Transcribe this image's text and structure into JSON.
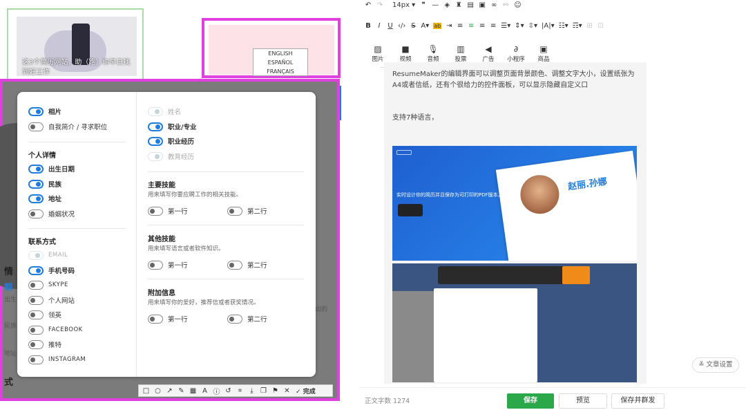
{
  "left": {
    "thumb_caption": "这3个简历网站，助（跑）你早日找到好工作",
    "languages": [
      "ENGLISH",
      "ESPAÑOL",
      "FRANÇAIS"
    ],
    "side_text": [
      "情",
      "朝",
      "出生",
      "民族",
      "地址",
      "式"
    ],
    "side_right": "出的"
  },
  "panel": {
    "col1": {
      "top_items": [
        {
          "label": "相片",
          "state": "on"
        },
        {
          "label": "自我简介 / 寻求职位",
          "state": "off"
        }
      ],
      "personal_title": "个人详情",
      "personal_items": [
        {
          "label": "出生日期",
          "state": "on"
        },
        {
          "label": "民族",
          "state": "on"
        },
        {
          "label": "地址",
          "state": "on"
        },
        {
          "label": "婚姻状况",
          "state": "off"
        }
      ],
      "contact_title": "联系方式",
      "contact_items": [
        {
          "label": "EMAIL",
          "state": "dis"
        },
        {
          "label": "手机号码",
          "state": "on"
        },
        {
          "label": "SKYPE",
          "state": "off"
        },
        {
          "label": "个人网站",
          "state": "off"
        },
        {
          "label": "领英",
          "state": "off"
        },
        {
          "label": "FACEBOOK",
          "state": "off"
        },
        {
          "label": "推特",
          "state": "off"
        },
        {
          "label": "INSTAGRAM",
          "state": "off"
        }
      ]
    },
    "col2": {
      "top_items": [
        {
          "label": "姓名",
          "state": "dis"
        },
        {
          "label": "职业/专业",
          "state": "on"
        },
        {
          "label": "职业经历",
          "state": "on"
        },
        {
          "label": "教育经历",
          "state": "dis"
        }
      ],
      "sections": [
        {
          "title": "主要技能",
          "desc": "用来填写你要应聘工作的相关技能。",
          "opt1": "第一行",
          "opt2": "第二行"
        },
        {
          "title": "其他技能",
          "desc": "用来填写语言或者软件知识。",
          "opt1": "第一行",
          "opt2": "第二行"
        },
        {
          "title": "附加信息",
          "desc": "用来填写你的爱好，推荐信或者获奖情况。",
          "opt1": "第一行",
          "opt2": "第二行"
        }
      ]
    }
  },
  "ann_tools": {
    "done": "完成"
  },
  "editor": {
    "font_size": "14px",
    "media": [
      {
        "icon": "image-icon",
        "label": "图片"
      },
      {
        "icon": "video-icon",
        "label": "视频"
      },
      {
        "icon": "audio-icon",
        "label": "音频"
      },
      {
        "icon": "poll-icon",
        "label": "投票"
      },
      {
        "icon": "ad-icon",
        "label": "广告"
      },
      {
        "icon": "miniprogram-icon",
        "label": "小程序"
      },
      {
        "icon": "product-icon",
        "label": "商品"
      }
    ],
    "para1": "ResumeMaker的编辑界面可以调整页面背景颜色、调整文字大小，设置纸张为A4或者信纸，还有个很给力的控件面板，可以显示隐藏自定义口",
    "para2": "支持7种语言，",
    "img1_text": "实时设计你的简历并且保存为可打印的PDF版本。",
    "img1_name": "赵丽.孙娜",
    "word_count_label": "正文字数",
    "word_count": "1274",
    "save": "保存",
    "preview": "预览",
    "save_publish": "保存并群发",
    "article_settings": "文章设置"
  },
  "colors": {
    "accent": "#1e7ce0",
    "highlight": "#e040e0",
    "save_green": "#2aa84a"
  }
}
